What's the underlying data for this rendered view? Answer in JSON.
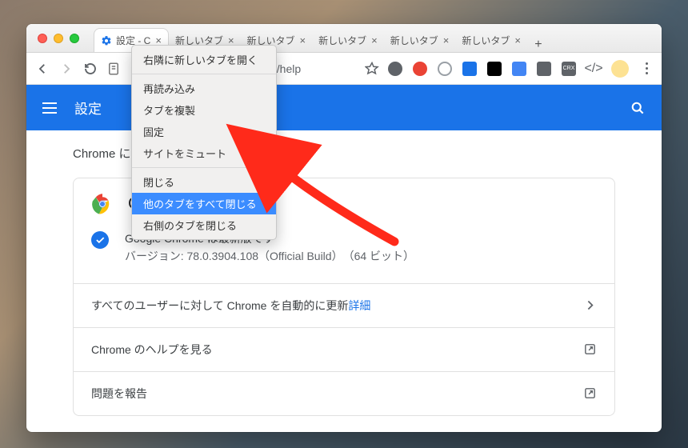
{
  "tabs": [
    {
      "label": "設定 - C",
      "active": true,
      "hasIcon": true
    },
    {
      "label": "新しいタブ"
    },
    {
      "label": "新しいタブ"
    },
    {
      "label": "新しいタブ"
    },
    {
      "label": "新しいタブ"
    },
    {
      "label": "新しいタブ"
    }
  ],
  "url_suffix": "gs/help",
  "app_bar_title": "設定",
  "sub_heading": "Chrome に",
  "card": {
    "title": "Google Chrome",
    "status_line1": "Google Chrome は最新版です",
    "status_line2": "バージョン: 78.0.3904.108（Official Build）　（64 ビット）"
  },
  "rows": {
    "r1_text": "すべてのユーザーに対して Chrome を自動的に更新 ",
    "r1_link": "詳細",
    "r2_text": "Chrome のヘルプを見る",
    "r3_text": "問題を報告"
  },
  "ctx": {
    "i0": "右隣に新しいタブを開く",
    "i1": "再読み込み",
    "i2": "タブを複製",
    "i3": "固定",
    "i4": "サイトをミュート",
    "i5": "閉じる",
    "i6": "他のタブをすべて閉じる",
    "i7": "右側のタブを閉じる"
  }
}
